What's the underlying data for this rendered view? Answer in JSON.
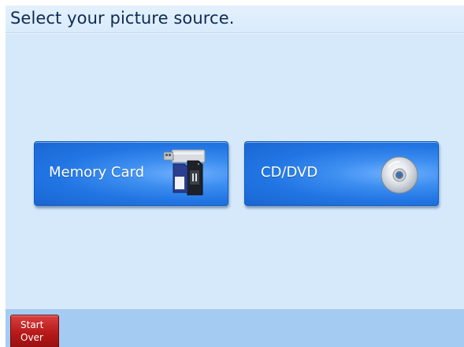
{
  "header": {
    "title": "Select your picture source."
  },
  "sources": [
    {
      "label": "Memory Card",
      "icon": "memory-card-icon"
    },
    {
      "label": "CD/DVD",
      "icon": "disc-icon"
    }
  ],
  "footer": {
    "start_over_label": "Start\nOver"
  },
  "colors": {
    "background": "#d6e9fb",
    "button_blue": "#2175e3",
    "start_over_red": "#b81a1a",
    "footer": "#a4ccf2",
    "title_text": "#0e2a55"
  }
}
